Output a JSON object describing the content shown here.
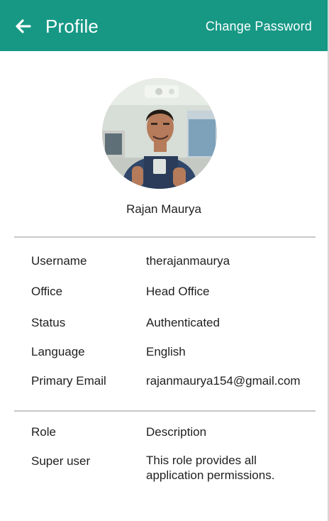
{
  "toolbar": {
    "title": "Profile",
    "back_icon": "arrow-left-icon",
    "action_label": "Change Password",
    "background": "#169885",
    "text_color": "#ffffff"
  },
  "profile": {
    "name": "Rajan Maurya",
    "avatar": "profile-photo"
  },
  "details": [
    {
      "label": "Username",
      "value": "therajanmaurya"
    },
    {
      "label": "Office",
      "value": "Head Office"
    },
    {
      "label": "Status",
      "value": "Authenticated"
    },
    {
      "label": "Language",
      "value": "English"
    },
    {
      "label": "Primary Email",
      "value": "rajanmaurya154@gmail.com"
    }
  ],
  "roles": {
    "header": {
      "label": "Role",
      "value": "Description"
    },
    "items": [
      {
        "label": "Super user",
        "value": "This role provides all application permissions."
      }
    ]
  }
}
